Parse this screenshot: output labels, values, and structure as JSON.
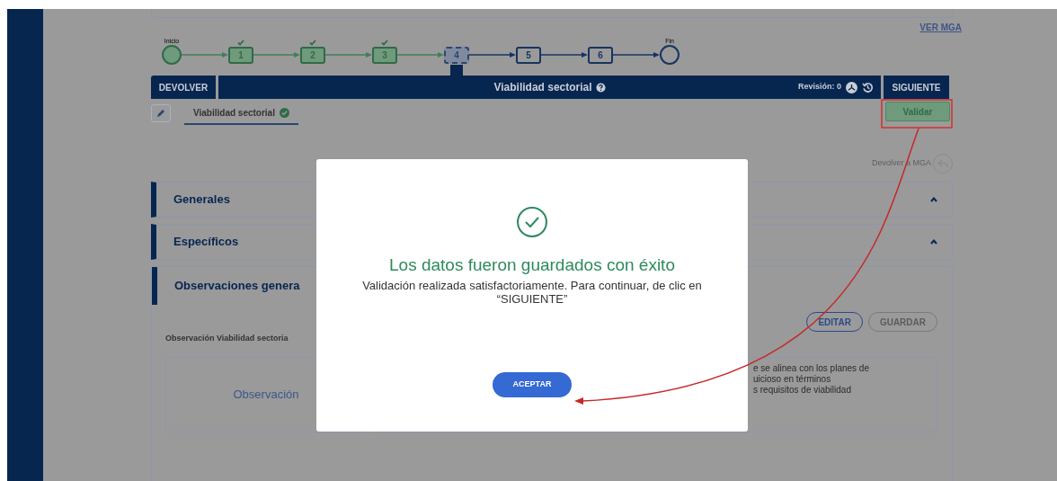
{
  "top_link": "VER MGA",
  "stepper": [
    {
      "kind": "start",
      "label": "Inicio",
      "completed": true,
      "selected": false
    },
    {
      "kind": "step",
      "label": "1",
      "completed": true,
      "selected": false
    },
    {
      "kind": "step",
      "label": "2",
      "completed": true,
      "selected": false
    },
    {
      "kind": "step",
      "label": "3",
      "completed": true,
      "selected": false
    },
    {
      "kind": "step",
      "label": "4",
      "completed": false,
      "selected": true
    },
    {
      "kind": "step",
      "label": "5",
      "completed": false,
      "selected": false
    },
    {
      "kind": "step",
      "label": "6",
      "completed": false,
      "selected": false
    },
    {
      "kind": "end",
      "label": "Fin",
      "completed": false,
      "selected": false
    }
  ],
  "action_bar": {
    "back": "DEVOLVER",
    "title": "Viabilidad sectorial",
    "revision": "Revisión: 0",
    "next": "SIGUIENTE"
  },
  "tabs": [
    {
      "label": "Viabilidad sectorial",
      "selected": true,
      "validated": true
    }
  ],
  "validate_button": "Validar",
  "return_link": "Devolver a MGA",
  "sections": [
    {
      "title": "Generales",
      "expanded": false
    },
    {
      "title": "Específicos",
      "expanded": false
    }
  ],
  "observations": {
    "title": "Observaciones genera",
    "edit": "EDITAR",
    "save": "GUARDAR",
    "save_disabled": true,
    "label": "Observación Viabilidad sectoria",
    "cell_label": "Observación",
    "text_lines": [
      "e se alinea con los planes de",
      "uicioso en términos",
      "s requisitos de viabilidad"
    ]
  },
  "modal": {
    "title": "Los datos fueron guardados con éxito",
    "message": "Validación realizada satisfactoriamente. Para continuar, de clic en “SIGUIENTE”",
    "button": "ACEPTAR"
  }
}
